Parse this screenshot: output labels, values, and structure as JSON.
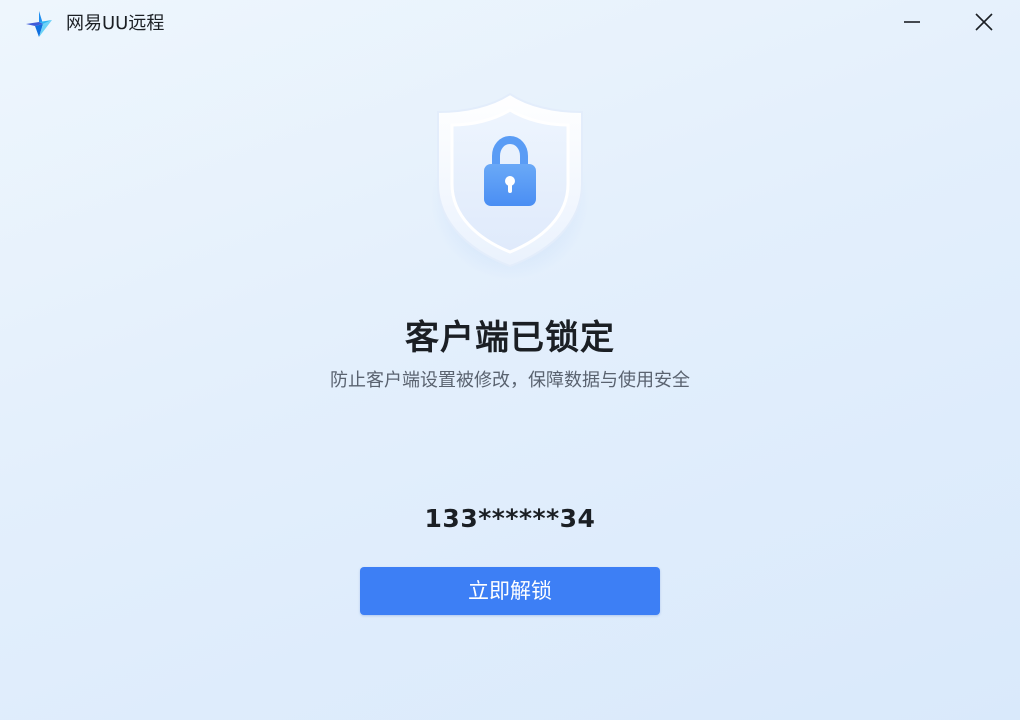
{
  "window": {
    "title": "网易UU远程",
    "logo_icon": "uu-logo-icon",
    "minimize_icon": "minimize-icon",
    "close_icon": "close-icon"
  },
  "lock_screen": {
    "shield_icon": "shield-lock-icon",
    "headline": "客户端已锁定",
    "description": "防止客户端设置被修改，保障数据与使用安全",
    "account": "133******34",
    "unlock_button_label": "立即解锁"
  },
  "colors": {
    "accent": "#3d7ff5",
    "lock_icon": "#5a9cf5",
    "background_start": "#eef6fd",
    "background_end": "#d9e9fb"
  }
}
